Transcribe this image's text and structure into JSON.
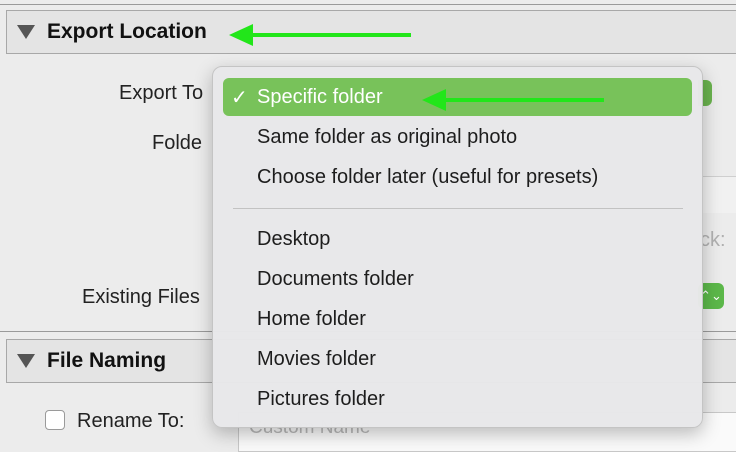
{
  "sections": {
    "export_location": {
      "title": "Export Location"
    },
    "file_naming": {
      "title": "File Naming"
    }
  },
  "export_location": {
    "export_to_label": "Export To",
    "folder_label": "Folde",
    "existing_files_label": "Existing Files",
    "partial_text": "ck:",
    "stepper_glyph": "⌃⌄"
  },
  "file_naming": {
    "rename_label": "Rename To:",
    "rename_placeholder": "Custom Name",
    "rename_checked": false
  },
  "menu": {
    "checkmark": "✓",
    "items_group1": [
      "Specific folder",
      "Same folder as original photo",
      "Choose folder later (useful for presets)"
    ],
    "items_group2": [
      "Desktop",
      "Documents folder",
      "Home folder",
      "Movies folder",
      "Pictures folder"
    ],
    "selected": "Specific folder"
  },
  "colors": {
    "selection": "#78c25a",
    "annotation_arrow": "#22e61a",
    "stepper": "#5cb84a"
  }
}
